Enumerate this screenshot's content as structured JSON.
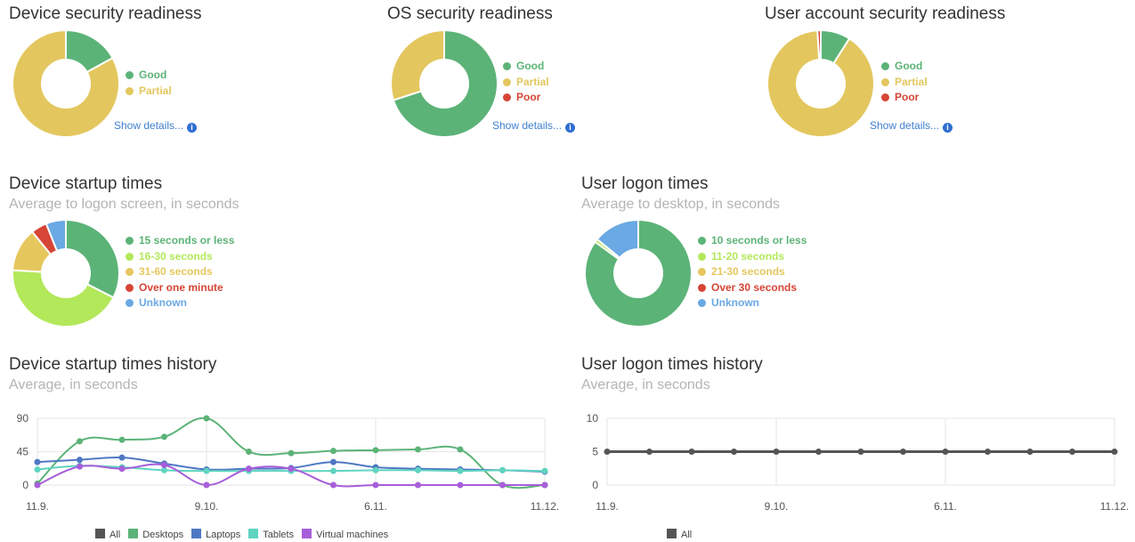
{
  "colors": {
    "good": "#5cb377",
    "partial": "#e3c75e",
    "poor": "#d64536",
    "lime": "#b3e85a",
    "yellow": "#e6c75e",
    "red": "#d64536",
    "blue": "#6aa9e3",
    "all": "#555555",
    "desktops": "#5cb377",
    "laptops": "#4e78c4",
    "tablets": "#5fd4c0",
    "vms": "#a75ed9"
  },
  "panels": {
    "device_security": {
      "title": "Device security readiness",
      "show_details": "Show details..."
    },
    "os_security": {
      "title": "OS security readiness",
      "show_details": "Show details..."
    },
    "user_security": {
      "title": "User account security readiness",
      "show_details": "Show details..."
    },
    "device_startup": {
      "title": "Device startup times",
      "subtitle": "Average to logon screen, in seconds"
    },
    "user_logon": {
      "title": "User logon times",
      "subtitle": "Average to desktop, in seconds"
    },
    "device_history": {
      "title": "Device startup times history",
      "subtitle": "Average, in seconds"
    },
    "user_history": {
      "title": "User logon times history",
      "subtitle": "Average, in seconds"
    }
  },
  "chart_data": [
    {
      "id": "device_security",
      "type": "pie",
      "labels": [
        "Good",
        "Partial"
      ],
      "values": [
        17,
        83
      ],
      "colors": [
        "#5cb377",
        "#e3c75e"
      ]
    },
    {
      "id": "os_security",
      "type": "pie",
      "labels": [
        "Good",
        "Partial",
        "Poor"
      ],
      "values": [
        70,
        30,
        0
      ],
      "colors": [
        "#5cb377",
        "#e3c75e",
        "#d64536"
      ]
    },
    {
      "id": "user_security",
      "type": "pie",
      "labels": [
        "Good",
        "Partial",
        "Poor"
      ],
      "values": [
        9,
        90,
        1
      ],
      "colors": [
        "#5cb377",
        "#e3c75e",
        "#d64536"
      ]
    },
    {
      "id": "device_startup",
      "type": "pie",
      "labels": [
        "15 seconds or less",
        "16-30 seconds",
        "31-60 seconds",
        "Over one minute",
        "Unknown"
      ],
      "values": [
        27,
        36,
        11,
        4,
        5
      ],
      "colors": [
        "#5cb377",
        "#b3e85a",
        "#e6c75e",
        "#d64536",
        "#6aa9e3"
      ]
    },
    {
      "id": "user_logon",
      "type": "pie",
      "labels": [
        "10 seconds or less",
        "11-20 seconds",
        "21-30 seconds",
        "Over 30 seconds",
        "Unknown"
      ],
      "values": [
        85,
        1,
        0,
        0,
        14
      ],
      "colors": [
        "#5cb377",
        "#b3e85a",
        "#e6c75e",
        "#d64536",
        "#6aa9e3"
      ]
    },
    {
      "id": "device_history",
      "type": "line",
      "x_ticks": [
        "11.9.",
        "9.10.",
        "6.11.",
        "11.12."
      ],
      "y_ticks": [
        "0",
        "45",
        "90"
      ],
      "ylim": [
        0,
        90
      ],
      "series": [
        {
          "name": "All",
          "color": "#555555",
          "values": []
        },
        {
          "name": "Desktops",
          "color": "#5cb377",
          "values": [
            2,
            59,
            61,
            65,
            90,
            45,
            43,
            46,
            47,
            48,
            48,
            0,
            0
          ]
        },
        {
          "name": "Laptops",
          "color": "#4e78c4",
          "values": [
            31,
            34,
            37,
            29,
            21,
            22,
            23,
            31,
            24,
            22,
            21,
            20,
            18
          ]
        },
        {
          "name": "Tablets",
          "color": "#5fd4c0",
          "values": [
            21,
            26,
            24,
            20,
            19,
            19,
            19,
            19,
            20,
            20,
            19,
            20,
            19
          ]
        },
        {
          "name": "Virtual machines",
          "color": "#a75ed9",
          "values": [
            0,
            25,
            22,
            27,
            0,
            22,
            22,
            0,
            0,
            0,
            0,
            0,
            0
          ]
        }
      ]
    },
    {
      "id": "user_history",
      "type": "line",
      "x_ticks": [
        "11.9.",
        "9.10.",
        "6.11.",
        "11.12."
      ],
      "y_ticks": [
        "0",
        "5",
        "10"
      ],
      "ylim": [
        0,
        10
      ],
      "series": [
        {
          "name": "All",
          "color": "#555555",
          "values": [
            5,
            5,
            5,
            5,
            5,
            5,
            5,
            5,
            5,
            5,
            5,
            5,
            5
          ]
        }
      ]
    }
  ]
}
